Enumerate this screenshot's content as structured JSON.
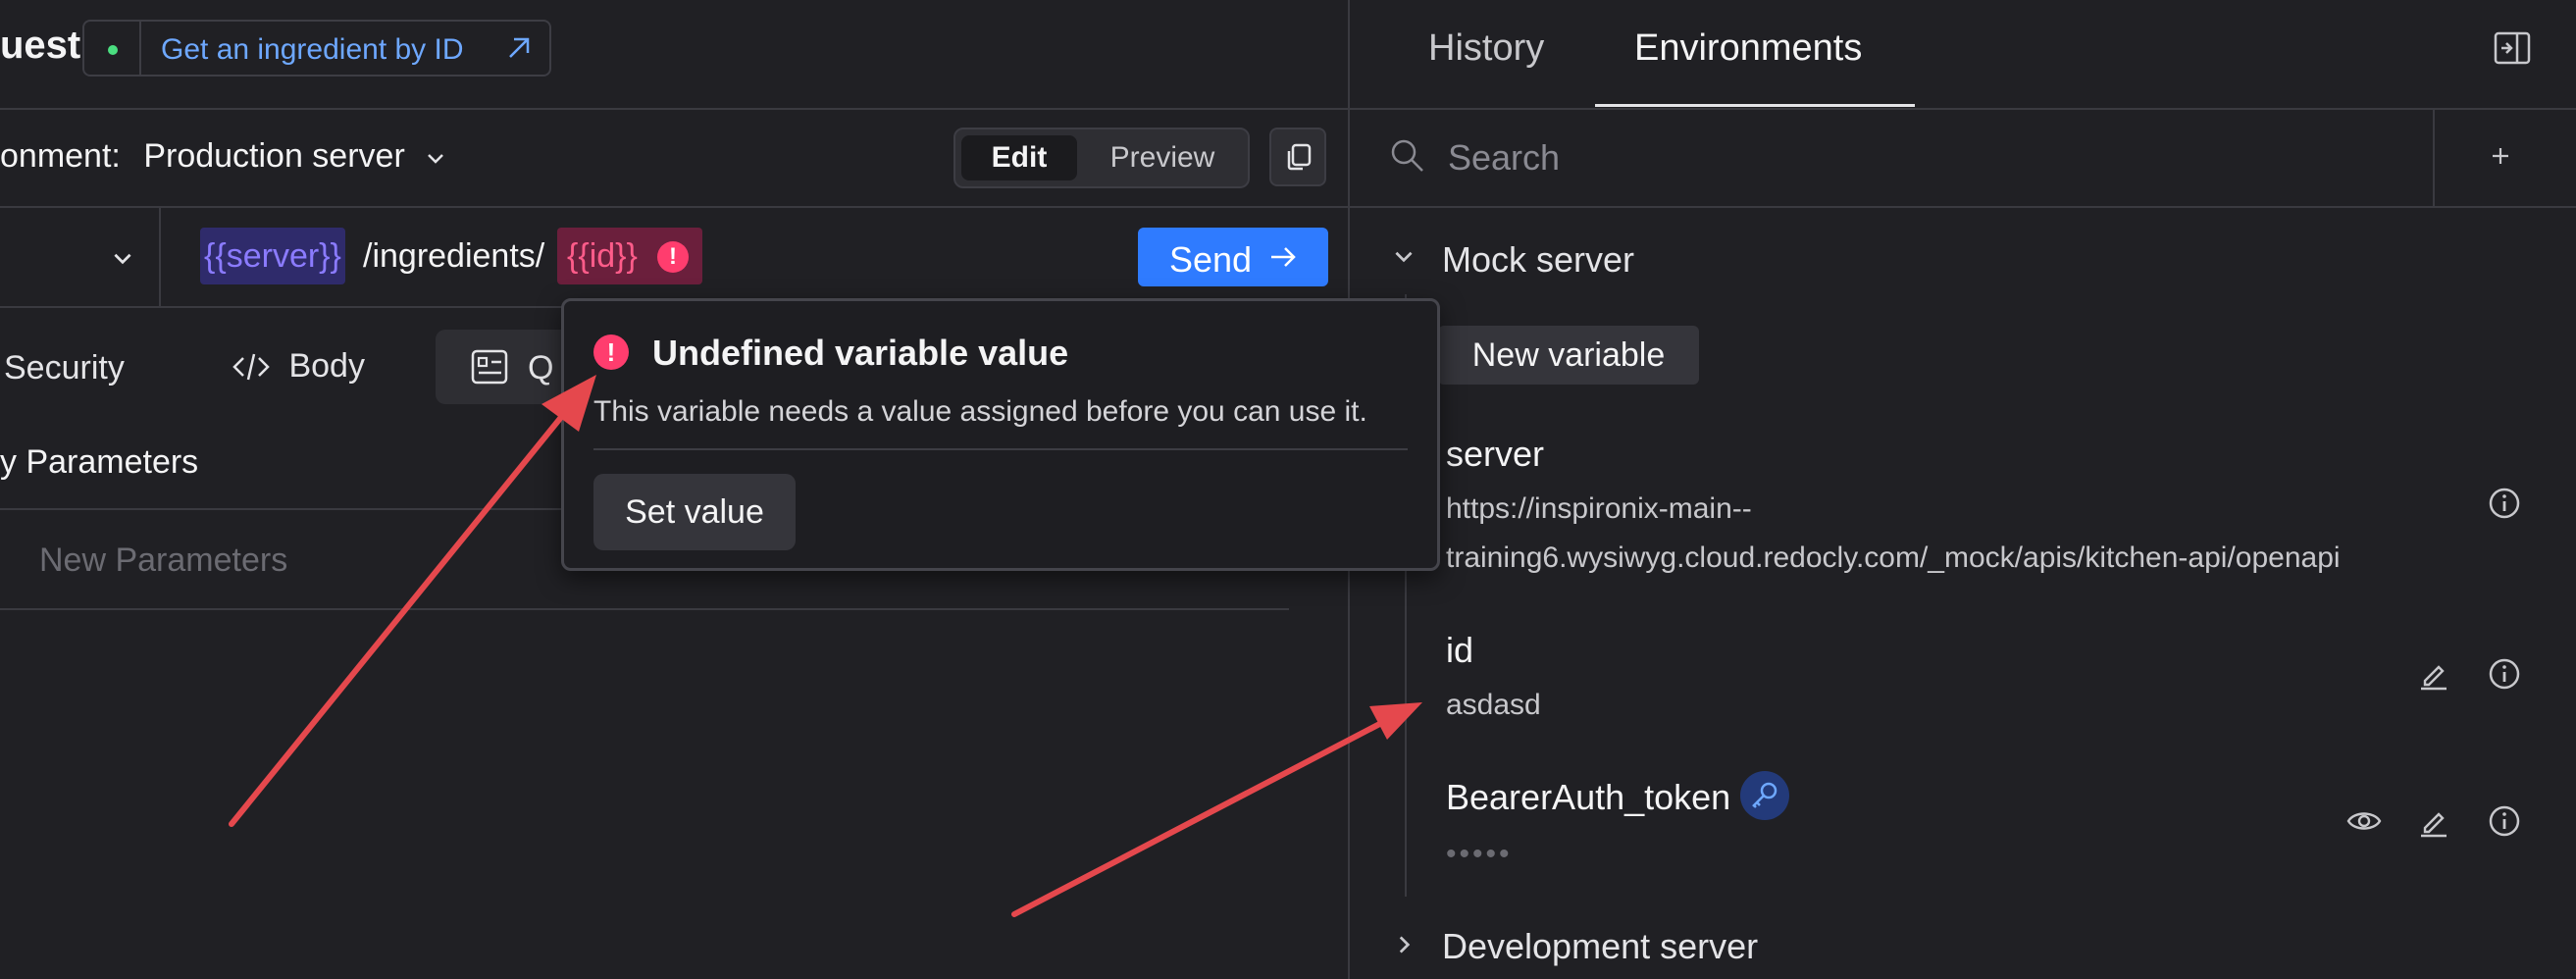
{
  "request": {
    "title": "uest",
    "operation_link": "Get an ingredient by ID",
    "environment_label": "onment:",
    "environment_value": "Production server",
    "mode_edit": "Edit",
    "mode_preview": "Preview",
    "url": {
      "server_var": "{{server}}",
      "path": "/ingredients/",
      "id_var": "{{id}}"
    },
    "send_label": "Send",
    "tabs": {
      "security": "Security",
      "body": "Body",
      "query_partial": "Q"
    },
    "params_title": "y Parameters",
    "new_param_placeholder": "New Parameters"
  },
  "popover": {
    "title": "Undefined variable value",
    "description": "This variable needs a value assigned before you can use it.",
    "button": "Set value"
  },
  "side_panel": {
    "tabs": [
      "History",
      "Environments"
    ],
    "active_tab": "Environments",
    "search_placeholder": "Search",
    "groups": {
      "mock": {
        "name": "Mock server",
        "new_variable": "New variable",
        "variables": {
          "server": {
            "name": "server",
            "value_line1": "https://inspironix-main--",
            "value_line2": "training6.wysiwyg.cloud.redocly.com/_mock/apis/kitchen-api/openapi"
          },
          "id": {
            "name": "id",
            "value": "asdasd"
          },
          "token": {
            "name": "BearerAuth_token",
            "value": "•••••"
          }
        }
      },
      "dev": {
        "name": "Development server"
      }
    }
  },
  "colors": {
    "background": "#202024",
    "accent": "#2f7bff",
    "error": "#ff3d6e",
    "annotation_arrow": "#e5484d"
  }
}
